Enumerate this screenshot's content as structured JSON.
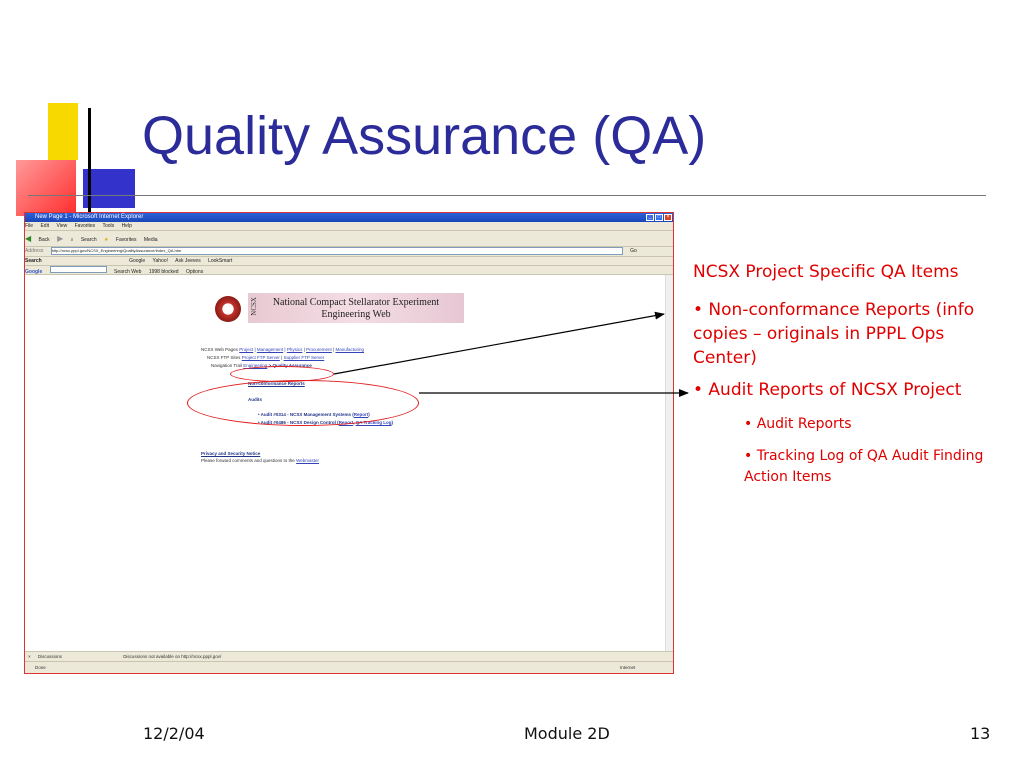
{
  "slide": {
    "title": "Quality Assurance (QA)",
    "footer_date": "12/2/04",
    "footer_module": "Module 2D",
    "footer_page": "13"
  },
  "browser": {
    "window_title": "New Page 1 - Microsoft Internet Explorer",
    "menu": [
      "File",
      "Edit",
      "View",
      "Favorites",
      "Tools",
      "Help"
    ],
    "toolbar": [
      "Back",
      "Search",
      "Favorites",
      "Media"
    ],
    "address_label": "Address",
    "address_value": "http://ncsx.pppl.gov/NCSX_Engineering/QualityAssurance/Index_QA.htm",
    "go_label": "Go",
    "search_label": "Search",
    "google_label": "Google",
    "yahoo_links": [
      "Google",
      "Yahoo!",
      "Ask Jeeves",
      "LookSmart"
    ],
    "google_toolbar": [
      "Search Web",
      "1998 blocked",
      "Options"
    ],
    "discussions_label": "Discussions",
    "discussions_status": "Discussions not available on http://ncsx.pppl.gov/",
    "status_left": "Done",
    "status_right": "Internet"
  },
  "webpage": {
    "banner_title_1": "National Compact Stellarator Experiment",
    "banner_title_2": "Engineering Web",
    "banner_ncsx": "NCSX",
    "web_pages_label": "NCSX Web Pages",
    "web_pages_links": [
      "Project",
      "Management",
      "Physics",
      "Procurement",
      "Manufacturing"
    ],
    "ftp_label": "NCSX FTP Sites",
    "ftp_links": [
      "Project FTP Server",
      "Supplier FTP Server"
    ],
    "nav_label": "Navigation Trail",
    "nav_link": "Engineering",
    "nav_current": "> Quality Assurance",
    "ncr_link": "Non-conformance Reports",
    "audits_heading": "Audits",
    "audit_1_text": "Audit #0314 - NCSX Management Systems (",
    "audit_1_link": "Report",
    "audit_2_text": "Audit #0486 - NCSX Design Control (",
    "audit_2_link_1": "Report",
    "audit_2_link_2": "QA Tracking Log",
    "privacy_link": "Privacy and Security Notice",
    "forward_text": "Please forward comments and questions to the",
    "webmaster_link": "Webmaster"
  },
  "annotations": {
    "heading": "NCSX Project Specific QA Items",
    "item_1": "• Non-conformance Reports (info copies – originals in PPPL Ops Center)",
    "item_2": "• Audit Reports of NCSX Project",
    "sub_1": "• Audit Reports",
    "sub_2": "• Tracking Log of QA Audit Finding Action Items"
  },
  "colors": {
    "title": "#2b2b99",
    "annotation": "#e00000",
    "ellipse": "#e01c1c"
  }
}
